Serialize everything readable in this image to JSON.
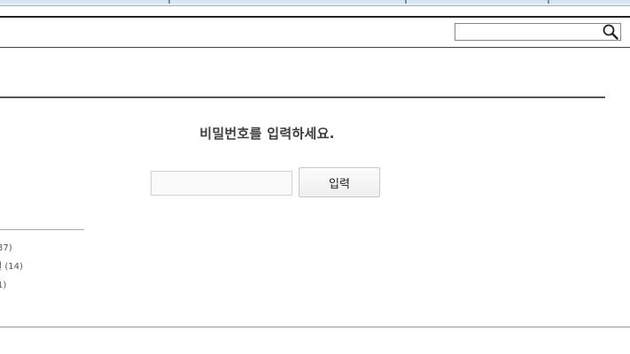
{
  "header": {
    "search": {
      "value": "",
      "placeholder": ""
    }
  },
  "password_form": {
    "prompt": "비밀번호를 입력하세요.",
    "input_value": "",
    "submit_label": "입력"
  },
  "sidebar": {
    "categories": [
      {
        "count_fragment": "37)"
      },
      {
        "label_fragment": "결",
        "count": "(14)"
      },
      {
        "count_fragment": "1)"
      }
    ]
  }
}
